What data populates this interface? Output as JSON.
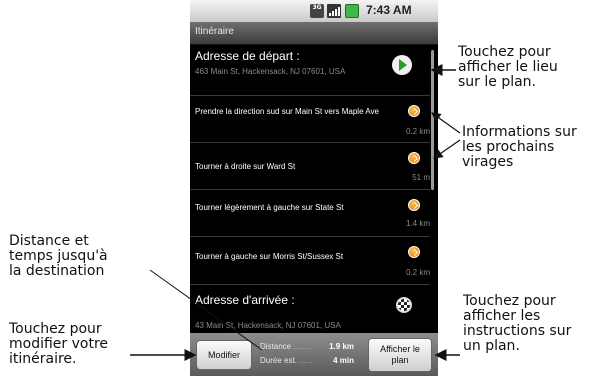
{
  "status_bar": {
    "network": "3G",
    "time": "7:43 AM"
  },
  "title_bar": {
    "title": "Itinéraire"
  },
  "start": {
    "title": "Adresse de départ :",
    "address": "463 Main St, Hackensack, NJ 07601, USA"
  },
  "steps": [
    {
      "text": "Prendre la direction sud sur Main St vers Maple Ave",
      "distance": "0.2 km"
    },
    {
      "text": "Tourner à droite sur Ward St",
      "distance": "51 m"
    },
    {
      "text": "Tourner légèrement à gauche sur State St",
      "distance": "1.4 km"
    },
    {
      "text": "Tourner à gauche sur Morris St/Sussex St",
      "distance": "0.2 km"
    }
  ],
  "end": {
    "title": "Adresse d'arrivée :",
    "address": "43 Main St, Hackensack, NJ 07601, USA"
  },
  "bottom_bar": {
    "modify_label": "Modifier",
    "distance_label": "Distance",
    "distance_value": "1.9 km",
    "duration_label": "Durée est.",
    "duration_value": "4 min",
    "map_label_line1": "Afficher le",
    "map_label_line2": "plan"
  },
  "annotations": {
    "start_pin": [
      "Touchez pour",
      "afficher le lieu",
      "sur le plan."
    ],
    "turns": [
      "Informations sur",
      "les prochains",
      "virages"
    ],
    "distance": [
      "Distance et",
      "temps jusqu'à",
      "la destination"
    ],
    "modify": [
      "Touchez pour",
      "modifier votre",
      "itinéraire."
    ],
    "map": [
      "Touchez pour",
      "afficher les",
      "instructions sur",
      "un plan."
    ]
  }
}
